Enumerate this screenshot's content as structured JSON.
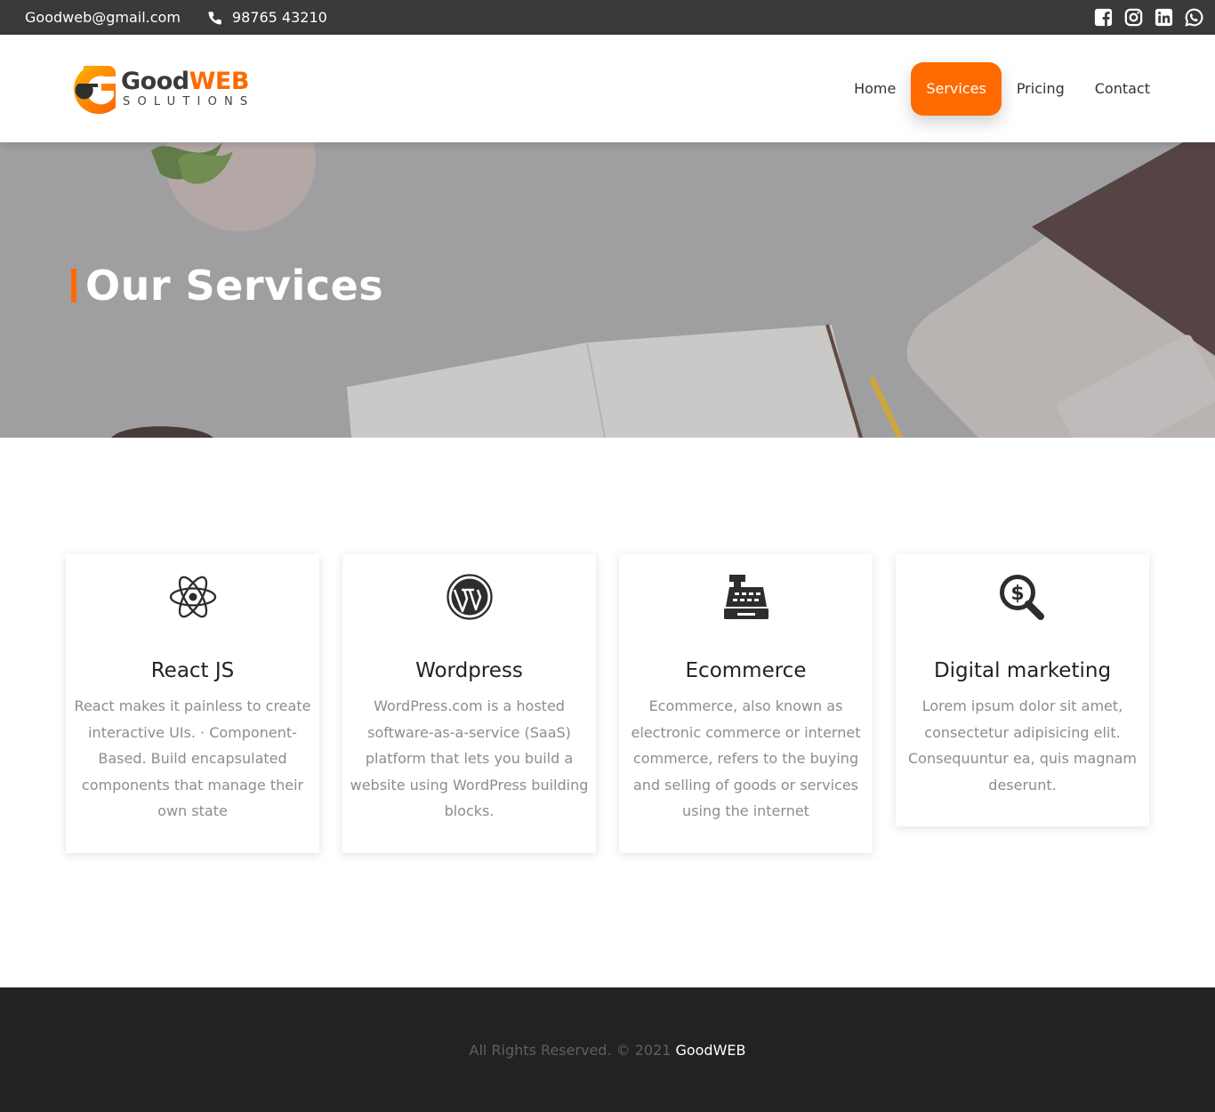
{
  "topbar": {
    "email": "Goodweb@gmail.com",
    "phone": "98765 43210",
    "social": [
      "facebook-icon",
      "instagram-icon",
      "linkedin-icon",
      "whatsapp-icon"
    ]
  },
  "logo": {
    "word1": "Good",
    "word2": "WEB",
    "tagline": "SOLUTIONS"
  },
  "nav": {
    "items": [
      {
        "label": "Home"
      },
      {
        "label": "Services",
        "active": true
      },
      {
        "label": "Pricing"
      },
      {
        "label": "Contact"
      }
    ]
  },
  "hero": {
    "title": "Our Services"
  },
  "services": [
    {
      "icon": "react-atom-icon",
      "title": "React JS",
      "text": "React makes it painless to create interactive UIs. · Component-Based. Build encapsulated components that manage their own state"
    },
    {
      "icon": "wordpress-icon",
      "title": "Wordpress",
      "text": "WordPress.com is a hosted software-as-a-service (SaaS) platform that lets you build a website using WordPress building blocks."
    },
    {
      "icon": "cash-register-icon",
      "title": "Ecommerce",
      "text": "Ecommerce, also known as electronic commerce or internet commerce, refers to the buying and selling of goods or services using the internet"
    },
    {
      "icon": "search-dollar-icon",
      "title": "Digital marketing",
      "text": "Lorem ipsum dolor sit amet, consectetur adipisicing elit. Consequuntur ea, quis magnam deserunt."
    }
  ],
  "footer": {
    "text": "All Rights Reserved. © 2021",
    "brand": "GoodWEB"
  },
  "colors": {
    "accent": "#ff6a00",
    "topbar": "#3a3a3a",
    "footer": "#222222"
  }
}
